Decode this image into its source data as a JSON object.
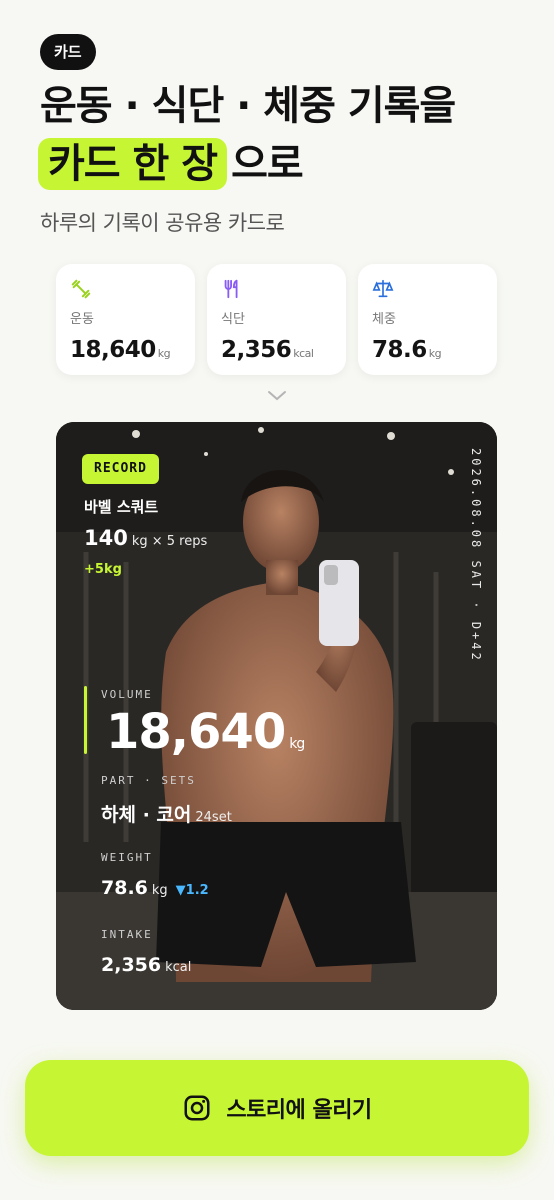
{
  "tag": "카드",
  "headline": {
    "line1": "운동 · 식단 · 체중 기록을",
    "highlight": "카드 한 장",
    "line2_rest": "으로"
  },
  "subtitle": "하루의 기록이 공유용 카드로",
  "stats": [
    {
      "icon": "dumbbell-icon",
      "label": "운동",
      "value": "18,640",
      "unit": "kg",
      "color": "#9bd21f"
    },
    {
      "icon": "fork-knife-icon",
      "label": "식단",
      "value": "2,356",
      "unit": "kcal",
      "color": "#8a5cf6"
    },
    {
      "icon": "scale-icon",
      "label": "체중",
      "value": "78.6",
      "unit": "kg",
      "color": "#2a6fdb"
    }
  ],
  "card": {
    "badge": "RECORD",
    "date": "2026.08.08 SAT · D+42",
    "exercise": "바벨 스쿼트",
    "weight": "140",
    "sets_detail": "kg × 5 reps",
    "delta": "+5kg",
    "volume_label": "VOLUME",
    "volume": "18,640",
    "volume_unit": "kg",
    "part_label": "PART · SETS",
    "part": "하체 · 코어",
    "part_sets": "24set",
    "weight_label": "WEIGHT",
    "body_weight": "78.6",
    "body_weight_unit": "kg",
    "body_weight_delta": "▼1.2",
    "intake_label": "INTAKE",
    "intake": "2,356",
    "intake_unit": "kcal"
  },
  "cta": {
    "label": "스토리에 올리기",
    "icon": "instagram-icon"
  },
  "colors": {
    "accent": "#c6f534",
    "background": "#f7f8f3"
  }
}
